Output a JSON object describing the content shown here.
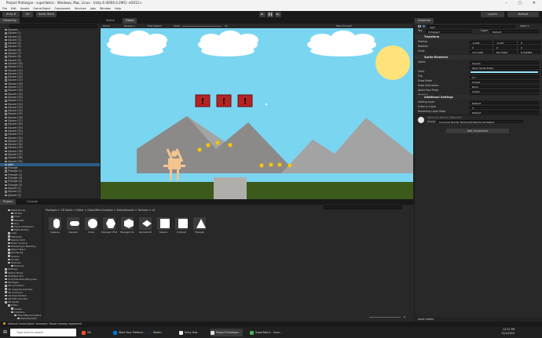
{
  "window": {
    "title": "Project Prototype - superfabric - Windows, Mac, Linux - Unity 6 (6000.0.29f1) <DX11>"
  },
  "menu": [
    "File",
    "Edit",
    "Assets",
    "GameObject",
    "Component",
    "Services",
    "Jobs",
    "Window",
    "Help"
  ],
  "toolbar": {
    "account": "Unity 6",
    "cloud": "UU",
    "asset_store": "Asset Store",
    "layers": "Layers",
    "layout": "Default"
  },
  "hierarchy": {
    "tab": "Hierarchy",
    "items": [
      "Squares",
      "Square (1)",
      "Square (2)",
      "Square (3)",
      "Square (4)",
      "Square (5)",
      "Square (6)",
      "Square (7)",
      "Square (8)",
      "Square (9)",
      "Square (10)",
      "Square (11)",
      "Square (12)",
      "Square (13)",
      "Square (14)",
      "Square (15)",
      "Square (16)",
      "Square (17)",
      "Square (18)",
      "Square (19)",
      "Square (20)",
      "Square (21)",
      "Square (22)",
      "Square (23)",
      "Square (24)",
      "Square (25)",
      "Square (26)",
      "Square (27)",
      "Square (28)",
      "Square (29)",
      "Square (30)",
      "Square (31)",
      "Square (32)",
      "Square (33)",
      "Square (34)",
      "Square (35)",
      "Square (36)",
      "Square (37)",
      "Square (38)",
      "Square (39)",
      "swirl",
      "Triangle",
      "Triangle (1)",
      "Triangle (2)",
      "Triangle (3)",
      "Triangle (4)",
      "Triangle (5)",
      "Square (1)",
      "Square (2)",
      "Square (3)",
      "Square (4)",
      "Square (5)",
      "Square (6)",
      "Square (7)",
      "Square (8)",
      "Square (9)",
      "Square (10)",
      "Circle",
      "Circle (1)",
      "Circle (2)",
      "Circle (3)",
      "Circle (4)",
      "Circle (5)",
      "Hexagon-Point Top",
      "Hexagon-Point Top (1)"
    ],
    "selected_index": 40
  },
  "scene": {
    "tabs": [
      "Scene",
      "Game"
    ],
    "game_view": "Game",
    "display": "Display 1",
    "aspect": "Free Aspect",
    "scale": "Scale",
    "scale_value": "1x",
    "play_focused": "Play Focused",
    "colors": {
      "sky": "#7ad5f1",
      "sun": "#ffe27a",
      "mountain_back": "#a3a3a3",
      "mountain_front": "#8c8a88",
      "ground": "#3c5a1c",
      "block": "#b52323",
      "coin": "#f1c40f",
      "player": "#f3c48f"
    }
  },
  "inspector": {
    "tab": "Inspector",
    "object_name": "swirl",
    "tag_label": "Tag",
    "tag": "Untagged",
    "layer_label": "Layer",
    "layer": "Default",
    "transform_title": "Transform",
    "position_label": "Position",
    "rotation_label": "Rotation",
    "scale_label": "Scale",
    "position": [
      "-9.092",
      "-0.507",
      "0"
    ],
    "rotation": [
      "0",
      "0",
      "0"
    ],
    "scale": [
      "119.1054",
      "68.75844",
      "6.034864"
    ],
    "renderer_title": "Sprite Renderer",
    "fields": [
      {
        "label": "Sprite",
        "value": "Square"
      },
      {
        "label": "",
        "value": "Open Sprite Editor"
      },
      {
        "label": "Color",
        "value": ""
      },
      {
        "label": "Flip",
        "value": "X   Y"
      },
      {
        "label": "Draw Mode",
        "value": "Simple"
      },
      {
        "label": "Mask Interaction",
        "value": "None"
      },
      {
        "label": "Sprite Sort Point",
        "value": "Center"
      },
      {
        "label": "Material",
        "value": "Sprite-Lit-Default"
      }
    ],
    "additional_title": "Additional Settings",
    "additional": [
      {
        "label": "Sorting Layer",
        "value": "Default"
      },
      {
        "label": "Order in Layer",
        "value": "0"
      },
      {
        "label": "Rendering Layer Mask",
        "value": "Default"
      }
    ],
    "material_name": "Sprite-Lit-Default (Material)",
    "shader_label": "Shader",
    "shader": "Universal Render Pipeline/2D/Sprite-Lit-Default",
    "add_component": "Add Component",
    "asset_labels": "Asset Labels",
    "color_swatch": "#96e8ff"
  },
  "project": {
    "tabs": [
      "Project",
      "Console"
    ],
    "breadcrumb": "Packages > 2D Sprite > Editor > ObjectMenuCreation > DefaultAssets > Textures > v2",
    "tree": [
      "Metal Boxes",
      "3P Box",
      "Food",
      "Obsidian",
      "Guy",
      "Input Containers",
      "Metal Button",
      "Logo",
      "Materials",
      "Mentor Rich",
      "Music Archive",
      "Modelling & Meshing",
      "Object Menu",
      "Rendering",
      "Scenes",
      "Scripts",
      "Textures",
      "Textures",
      "Settings",
      "Switch Packs",
      "TextMesh Pro",
      "UnityVisualScripting.Gen",
      "Packages",
      "2D Animation",
      "2D Aseprite Importer",
      "2D Common",
      "2D Pixel Perfect",
      "2D PSD Importer",
      "2D Sprite",
      "Editor",
      "Assets",
      "Interface",
      "ObjectMenuCreation",
      "DefaultAssets",
      "Textures",
      "v2"
    ],
    "assets": [
      "Capsule",
      "Capsule",
      "Circle",
      "Hexagon Flat",
      "Hexagon Po",
      "IsometricD",
      "Square",
      "9-Sliced",
      "Triangle"
    ],
    "slider": "9"
  },
  "status": {
    "message": "Default GameObject 'Animator' Model already registered"
  },
  "taskbar": {
    "search": "Type here to search",
    "items": [
      "Git",
      "Store Your Pretend...",
      "Steam",
      "Unity Hub",
      "Project Prototype...",
      "SuperFabric - Coun..."
    ],
    "time": "12:31 PM",
    "date": "12/1/2024"
  }
}
